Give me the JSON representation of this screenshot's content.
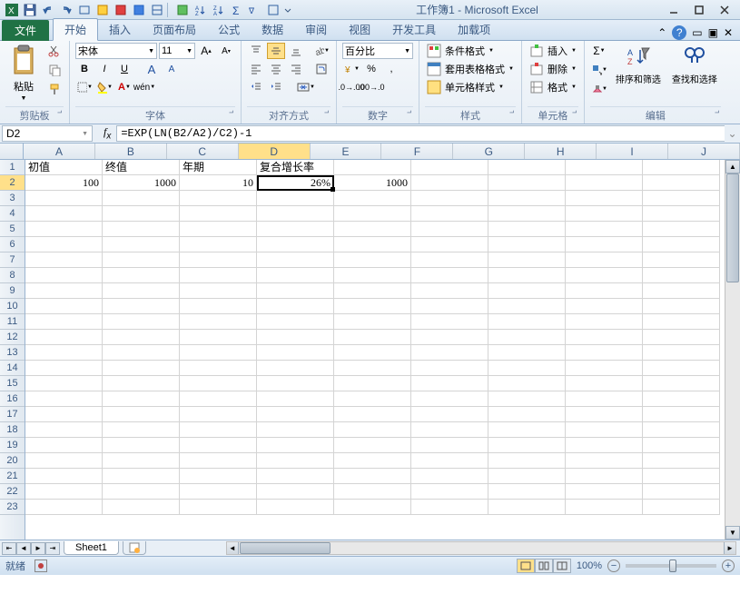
{
  "app": {
    "title": "工作簿1 - Microsoft Excel"
  },
  "tabs": {
    "file": "文件",
    "list": [
      "开始",
      "插入",
      "页面布局",
      "公式",
      "数据",
      "审阅",
      "视图",
      "开发工具",
      "加载项"
    ],
    "active": 0
  },
  "ribbon": {
    "clipboard": {
      "label": "剪贴板",
      "paste": "粘贴"
    },
    "font": {
      "label": "字体",
      "name": "宋体",
      "size": "11",
      "bold": "B",
      "italic": "I",
      "underline": "U"
    },
    "align": {
      "label": "对齐方式"
    },
    "number": {
      "label": "数字",
      "format": "百分比"
    },
    "styles": {
      "label": "样式",
      "cond": "条件格式",
      "table": "套用表格格式",
      "cell": "单元格样式"
    },
    "cells": {
      "label": "单元格",
      "insert": "插入",
      "delete": "删除",
      "format": "格式"
    },
    "editing": {
      "label": "编辑",
      "sort": "排序和筛选",
      "find": "查找和选择"
    }
  },
  "formula_bar": {
    "name_box": "D2",
    "formula": "=EXP(LN(B2/A2)/C2)-1"
  },
  "grid": {
    "columns": [
      "A",
      "B",
      "C",
      "D",
      "E",
      "F",
      "G",
      "H",
      "I",
      "J"
    ],
    "headers": [
      "初值",
      "终值",
      "年期",
      "复合增长率"
    ],
    "row2": {
      "A": "100",
      "B": "1000",
      "C": "10",
      "D": "26%",
      "E": "1000"
    },
    "active": {
      "col": 3,
      "row": 1
    },
    "selected_col": "D",
    "selected_row": "2"
  },
  "sheet": {
    "name": "Sheet1"
  },
  "status": {
    "ready": "就绪",
    "zoom": "100%"
  }
}
